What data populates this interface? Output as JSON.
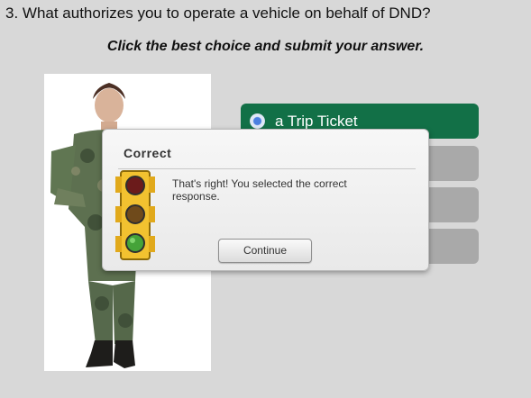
{
  "question": {
    "text": "3. What authorizes you to operate a vehicle on behalf of DND?"
  },
  "instruction": "Click the best choice and submit your answer.",
  "choices": [
    {
      "label": "a Trip Ticket",
      "selected": true
    },
    {
      "label": "",
      "selected": false
    },
    {
      "label": "",
      "selected": false
    },
    {
      "label": "",
      "selected": false
    }
  ],
  "dialog": {
    "title": "Correct",
    "message": "That's right!  You selected the correct response.",
    "continue_label": "Continue"
  },
  "icons": {
    "feedback": "traffic-light-icon",
    "selection": "radio-selected-icon"
  },
  "colors": {
    "selected_choice": "#127047",
    "unselected_choice": "#a9a9a9",
    "page_background": "#d8d8d8"
  }
}
